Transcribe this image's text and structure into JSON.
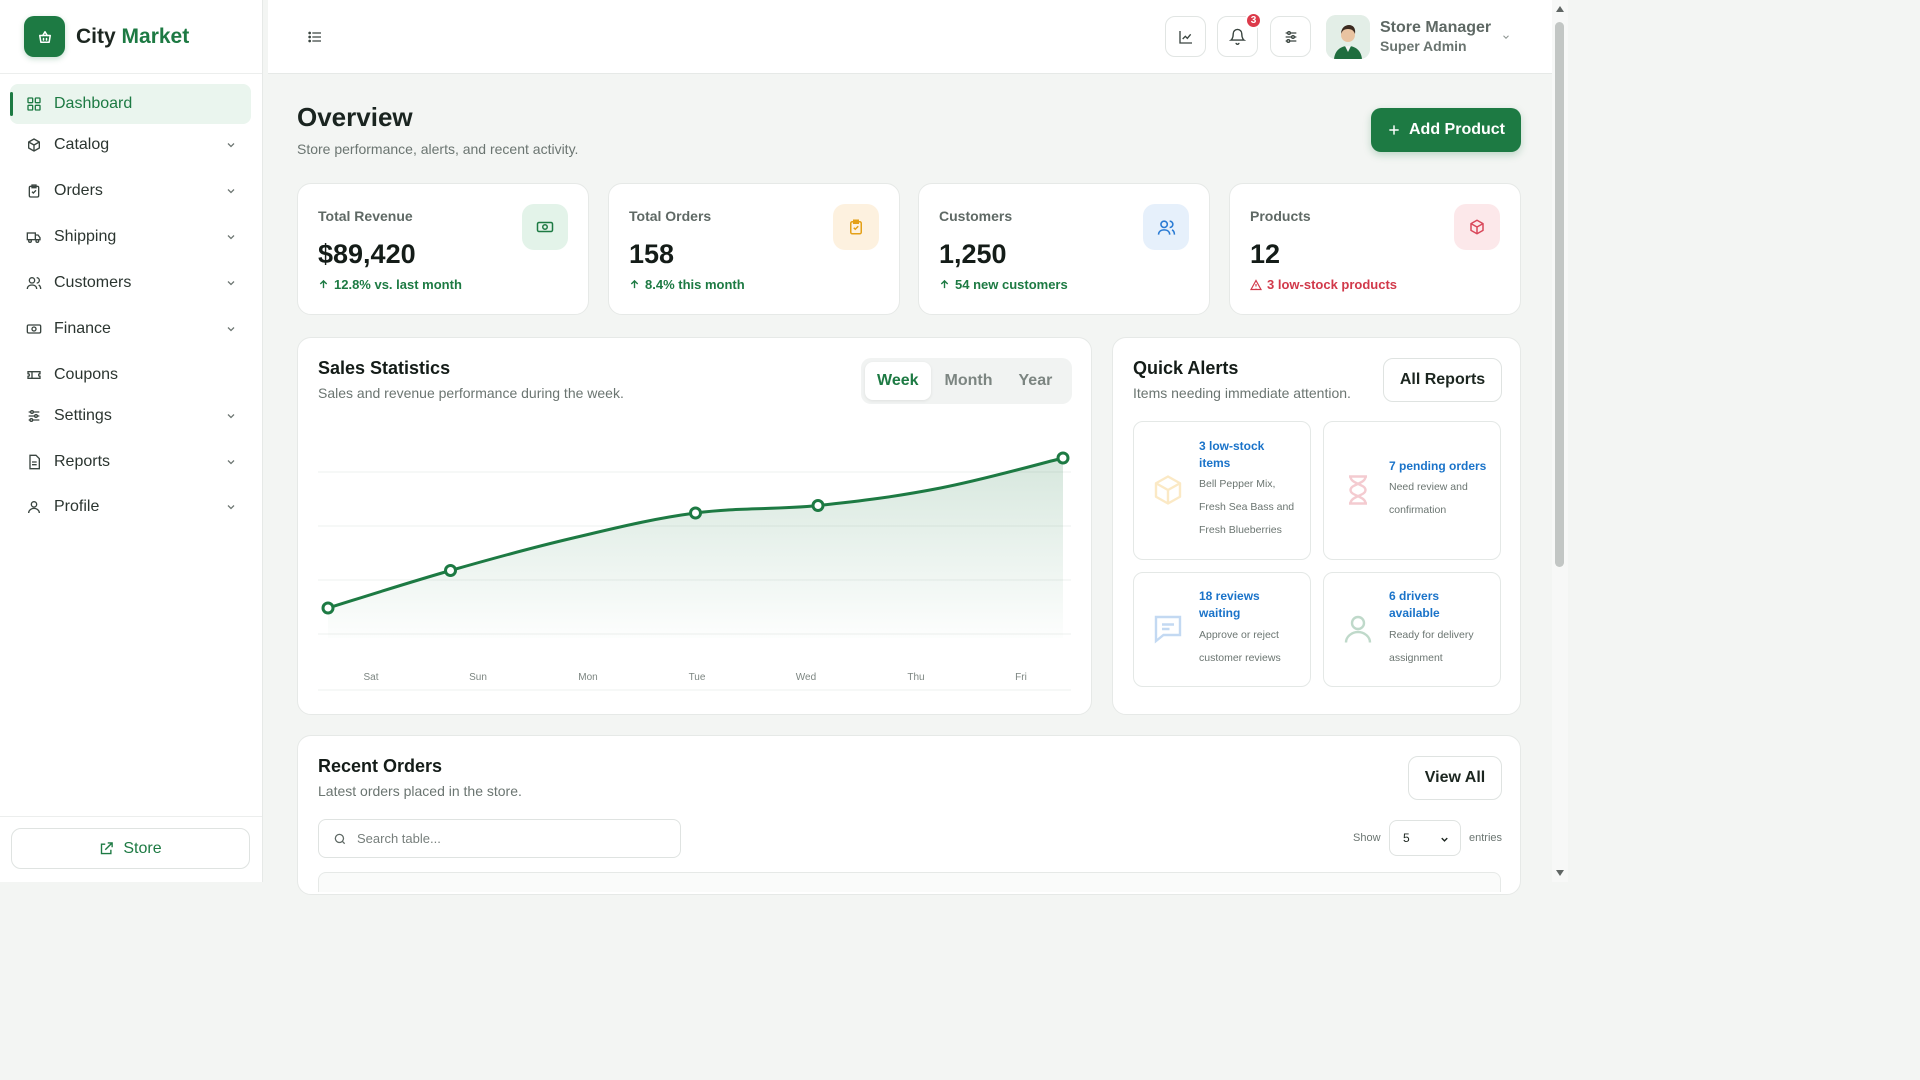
{
  "brand": {
    "name_part1": "City",
    "name_part2": "Market"
  },
  "sidebar": {
    "items": [
      {
        "label": "Dashboard",
        "icon": "grid-icon",
        "active": true,
        "has_submenu": false
      },
      {
        "label": "Catalog",
        "icon": "box-icon",
        "has_submenu": true
      },
      {
        "label": "Orders",
        "icon": "clipboard-icon",
        "has_submenu": true
      },
      {
        "label": "Shipping",
        "icon": "truck-icon",
        "has_submenu": true
      },
      {
        "label": "Customers",
        "icon": "users-icon",
        "has_submenu": true
      },
      {
        "label": "Finance",
        "icon": "cash-icon",
        "has_submenu": true
      },
      {
        "label": "Coupons",
        "icon": "ticket-icon",
        "has_submenu": false
      },
      {
        "label": "Settings",
        "icon": "sliders-icon",
        "has_submenu": true
      },
      {
        "label": "Reports",
        "icon": "file-icon",
        "has_submenu": true
      },
      {
        "label": "Profile",
        "icon": "user-icon",
        "has_submenu": true
      }
    ],
    "store_button": "Store"
  },
  "topbar": {
    "notification_count": "3",
    "user_name": "Store Manager",
    "user_role": "Super Admin"
  },
  "page": {
    "title": "Overview",
    "subtitle": "Store performance, alerts, and recent activity.",
    "add_button": "Add Product"
  },
  "stats": [
    {
      "title": "Total Revenue",
      "value": "$89,420",
      "note": "12.8% vs. last month",
      "tone": "green",
      "icon": "cash-icon"
    },
    {
      "title": "Total Orders",
      "value": "158",
      "note": "8.4% this month",
      "tone": "green",
      "icon": "clipboard-check-icon"
    },
    {
      "title": "Customers",
      "value": "1,250",
      "note": "54 new customers",
      "tone": "green",
      "icon": "users-icon"
    },
    {
      "title": "Products",
      "value": "12",
      "note": "3 low-stock products",
      "tone": "red",
      "icon": "box-icon"
    }
  ],
  "sales": {
    "title": "Sales Statistics",
    "subtitle": "Sales and revenue performance during the week.",
    "tabs": [
      "Week",
      "Month",
      "Year"
    ],
    "active_tab": "Week"
  },
  "chart_data": {
    "type": "area",
    "title": "Sales Statistics",
    "categories": [
      "Sat",
      "Sun",
      "Mon",
      "Tue",
      "Wed",
      "Thu",
      "Fri"
    ],
    "series": [
      {
        "values": [
          12,
          27,
          40,
          50,
          53,
          60,
          72
        ]
      }
    ],
    "ylim": [
      0,
      80
    ],
    "grid": true,
    "colors": {
      "line": "#1d7a43",
      "fill": "#1d7a43"
    }
  },
  "alerts": {
    "title": "Quick Alerts",
    "subtitle": "Items needing immediate attention.",
    "button": "All Reports",
    "items": [
      {
        "title": "3 low-stock items",
        "desc": "Bell Pepper Mix, Fresh Sea Bass and Fresh Blueberries",
        "icon": "box-icon",
        "color": "#f2b233"
      },
      {
        "title": "7 pending orders",
        "desc": "Need review and confirmation",
        "icon": "hourglass-icon",
        "color": "#d9475a"
      },
      {
        "title": "18 reviews waiting",
        "desc": "Approve or reject customer reviews",
        "icon": "message-icon",
        "color": "#2a7bd4"
      },
      {
        "title": "6 drivers available",
        "desc": "Ready for delivery assignment",
        "icon": "user-icon",
        "color": "#1d7a43"
      }
    ]
  },
  "orders": {
    "title": "Recent Orders",
    "subtitle": "Latest orders placed in the store.",
    "button": "View All",
    "search_placeholder": "Search table...",
    "show_label": "Show",
    "page_size": "5",
    "entries_label": "entries"
  }
}
